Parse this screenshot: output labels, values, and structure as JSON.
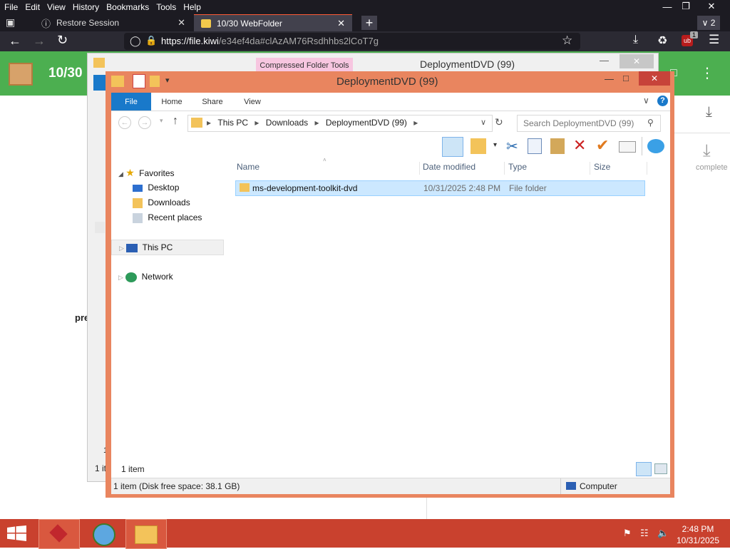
{
  "firefox": {
    "menu": [
      "File",
      "Edit",
      "View",
      "History",
      "Bookmarks",
      "Tools",
      "Help"
    ],
    "tabs": [
      {
        "label": "Restore Session"
      },
      {
        "label": "10/30 WebFolder"
      }
    ],
    "tab_count_badge": "2",
    "url_host": "https://file.kiwi",
    "url_path": "/e34ef4da#clAzAM76Rsdhhbs2lCoT7g",
    "ext_badge": "1"
  },
  "page": {
    "header_title": "10/30",
    "partial_text": "pre",
    "download_label": "complete",
    "partial_digit": "1",
    "partial_status": "1 it"
  },
  "back_window": {
    "title": "DeploymentDVD (99)",
    "context_tab": "Compressed Folder Tools"
  },
  "explorer": {
    "title": "DeploymentDVD (99)",
    "ribbon_tabs": [
      "File",
      "Home",
      "Share",
      "View"
    ],
    "breadcrumb": [
      "This PC",
      "Downloads",
      "DeploymentDVD (99)"
    ],
    "search_placeholder": "Search DeploymentDVD (99)",
    "nav": {
      "favorites": "Favorites",
      "favorites_items": [
        "Desktop",
        "Downloads",
        "Recent places"
      ],
      "this_pc": "This PC",
      "network": "Network"
    },
    "columns": [
      "Name",
      "Date modified",
      "Type",
      "Size"
    ],
    "rows": [
      {
        "name": "ms-development-toolkit-dvd",
        "date": "10/31/2025 2:48 PM",
        "type": "File folder",
        "size": ""
      }
    ],
    "item_count": "1 item",
    "status_left": "1 item (Disk free space: 38.1 GB)",
    "status_right": "Computer"
  },
  "taskbar": {
    "time": "2:48 PM",
    "date": "10/31/2025"
  },
  "colors": {
    "firefox_bg": "#1c1b22",
    "page_header": "#4caf50",
    "explorer_frame": "#e9855f",
    "taskbar": "#c9412e",
    "selection": "#cce8ff",
    "file_tab": "#1979ca"
  }
}
